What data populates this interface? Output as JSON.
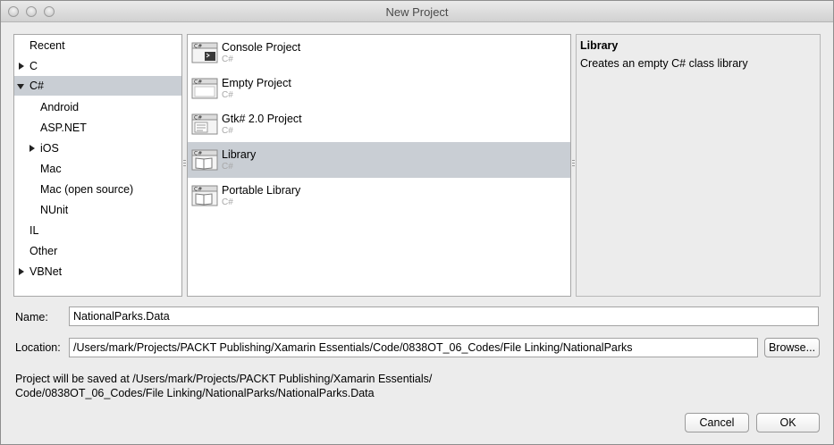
{
  "window": {
    "title": "New Project"
  },
  "categories": [
    {
      "label": "Recent",
      "expander": "none",
      "selected": false
    },
    {
      "label": "C",
      "expander": "collapsed",
      "selected": false
    },
    {
      "label": "C#",
      "expander": "expanded",
      "selected": true
    },
    {
      "label": "Android",
      "expander": "none",
      "selected": false
    },
    {
      "label": "ASP.NET",
      "expander": "none",
      "selected": false
    },
    {
      "label": "iOS",
      "expander": "collapsed",
      "selected": false
    },
    {
      "label": "Mac",
      "expander": "none",
      "selected": false
    },
    {
      "label": "Mac (open source)",
      "expander": "none",
      "selected": false
    },
    {
      "label": "NUnit",
      "expander": "none",
      "selected": false
    },
    {
      "label": "IL",
      "expander": "none",
      "selected": false
    },
    {
      "label": "Other",
      "expander": "none",
      "selected": false
    },
    {
      "label": "VBNet",
      "expander": "collapsed",
      "selected": false
    }
  ],
  "templates": [
    {
      "name": "Console Project",
      "language": "C#",
      "icon": "console-project-icon",
      "icon_badge": "C#",
      "selected": false
    },
    {
      "name": "Empty Project",
      "language": "C#",
      "icon": "empty-project-icon",
      "icon_badge": "C#",
      "selected": false
    },
    {
      "name": "Gtk# 2.0 Project",
      "language": "C#",
      "icon": "gtk-project-icon",
      "icon_badge": "C#",
      "selected": false
    },
    {
      "name": "Library",
      "language": "C#",
      "icon": "library-icon",
      "icon_badge": "C#",
      "selected": true
    },
    {
      "name": "Portable Library",
      "language": "C#",
      "icon": "portable-library-icon",
      "icon_badge": "C#",
      "selected": false
    }
  ],
  "description": {
    "title": "Library",
    "text": "Creates an empty C# class library"
  },
  "form": {
    "name_label": "Name:",
    "name_value": "NationalParks.Data",
    "location_label": "Location:",
    "location_value": "/Users/mark/Projects/PACKT Publishing/Xamarin Essentials/Code/0838OT_06_Codes/File Linking/NationalParks",
    "browse_label": "Browse..."
  },
  "save_info": {
    "line1": "Project will be saved at /Users/mark/Projects/PACKT Publishing/Xamarin Essentials/",
    "line2": "Code/0838OT_06_Codes/File Linking/NationalParks/NationalParks.Data"
  },
  "buttons": {
    "cancel": "Cancel",
    "ok": "OK"
  },
  "colors": {
    "selection": "#c9ced4",
    "window_bg": "#ececec",
    "secondary_text": "#a8a8a8"
  }
}
